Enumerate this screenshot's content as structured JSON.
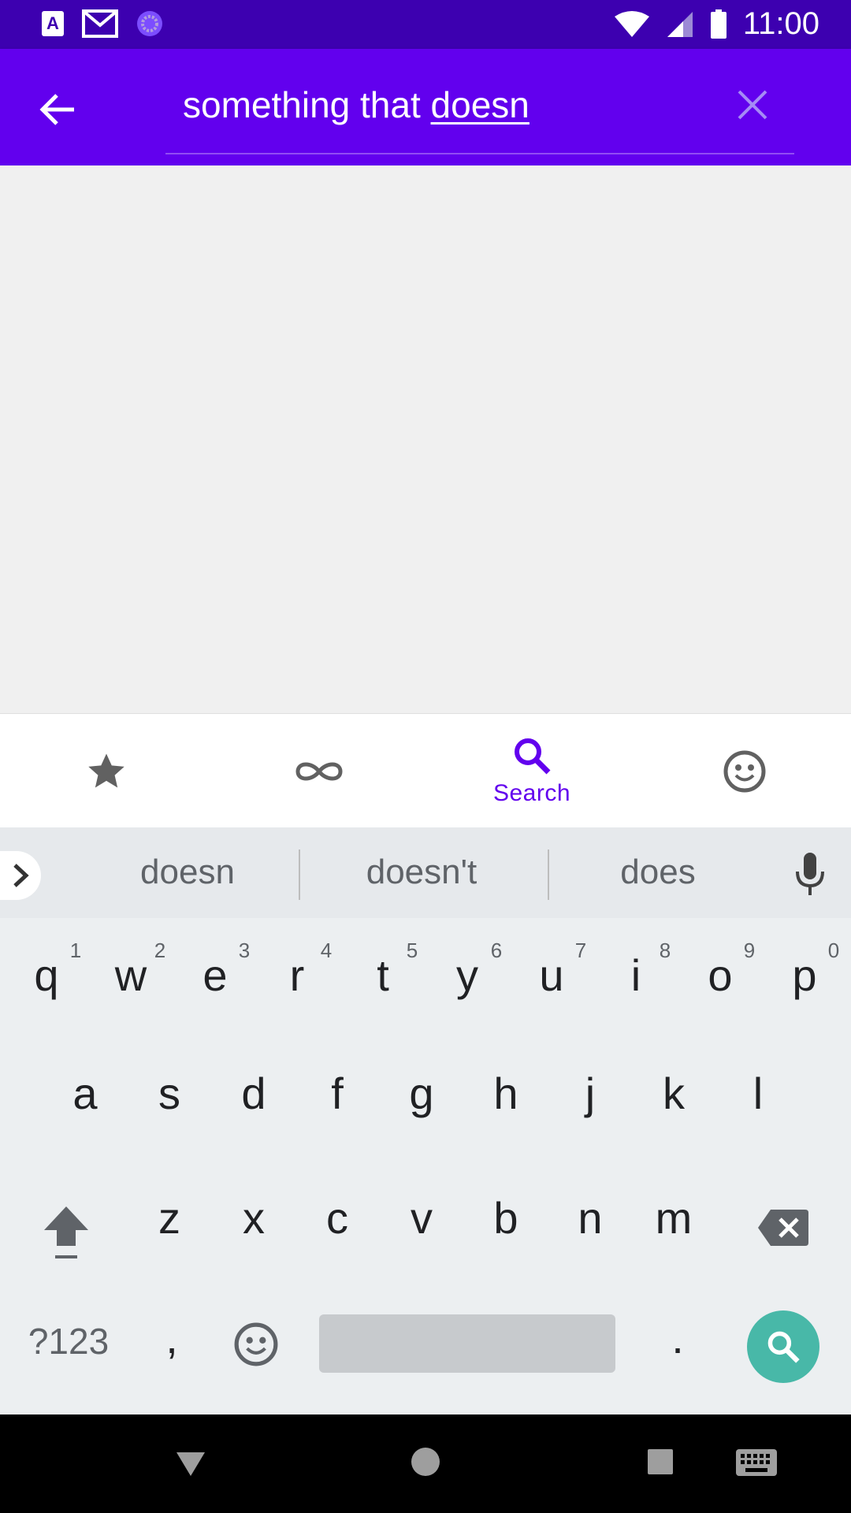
{
  "status_bar": {
    "time": "11:00",
    "icons": [
      "accessibility-app-icon",
      "gmail-icon",
      "sync-circle-icon",
      "wifi-icon",
      "signal-icon",
      "battery-icon"
    ]
  },
  "search": {
    "query_prefix": "something that ",
    "query_composing": "doesn"
  },
  "keyboard": {
    "tabs": [
      {
        "icon": "star-icon",
        "label": ""
      },
      {
        "icon": "infinity-icon",
        "label": ""
      },
      {
        "icon": "search-icon",
        "label": "Search"
      },
      {
        "icon": "emoji-icon",
        "label": ""
      }
    ],
    "suggestions": [
      "doesn",
      "doesn't",
      "does"
    ],
    "row1": [
      "q",
      "w",
      "e",
      "r",
      "t",
      "y",
      "u",
      "i",
      "o",
      "p"
    ],
    "row1_hints": [
      "1",
      "2",
      "3",
      "4",
      "5",
      "6",
      "7",
      "8",
      "9",
      "0"
    ],
    "row2": [
      "a",
      "s",
      "d",
      "f",
      "g",
      "h",
      "j",
      "k",
      "l"
    ],
    "row3": [
      "z",
      "x",
      "c",
      "v",
      "b",
      "n",
      "m"
    ],
    "symbols_label": "?123",
    "comma": ",",
    "period": "."
  },
  "colors": {
    "accent": "#6200ee",
    "status_bar": "#3d00b0",
    "search_key": "#48b8a8"
  }
}
